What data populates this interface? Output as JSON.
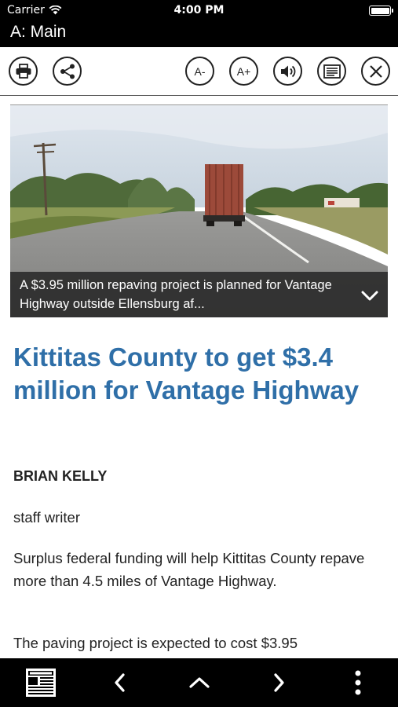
{
  "status_bar": {
    "carrier": "Carrier",
    "time": "4:00 PM"
  },
  "title_bar": {
    "title": "A: Main"
  },
  "toolbar": {
    "print_icon": "printer-icon",
    "share_icon": "share-icon",
    "font_decrease_label": "A-",
    "font_increase_label": "A+",
    "audio_icon": "speaker-icon",
    "text_view_icon": "text-view-icon",
    "close_icon": "close-icon"
  },
  "article": {
    "image_caption": "A $3.95 million repaving project is planned for Vantage Highway outside Ellensburg af...",
    "headline": "Kittitas County to get $3.4 million for Vantage Highway",
    "author": "BRIAN KELLY",
    "author_role": "staff writer",
    "paragraphs": [
      "Surplus federal funding will help Kittitas County repave more than 4.5 miles of Vantage Highway.",
      "The paving project is expected to cost $3.95"
    ]
  },
  "bottom_bar": {
    "newspaper_icon": "newspaper-icon",
    "prev_icon": "chevron-left-icon",
    "up_icon": "chevron-up-icon",
    "next_icon": "chevron-right-icon",
    "more_icon": "more-vertical-icon"
  },
  "colors": {
    "headline": "#2f6fa8",
    "bars": "#000000"
  }
}
